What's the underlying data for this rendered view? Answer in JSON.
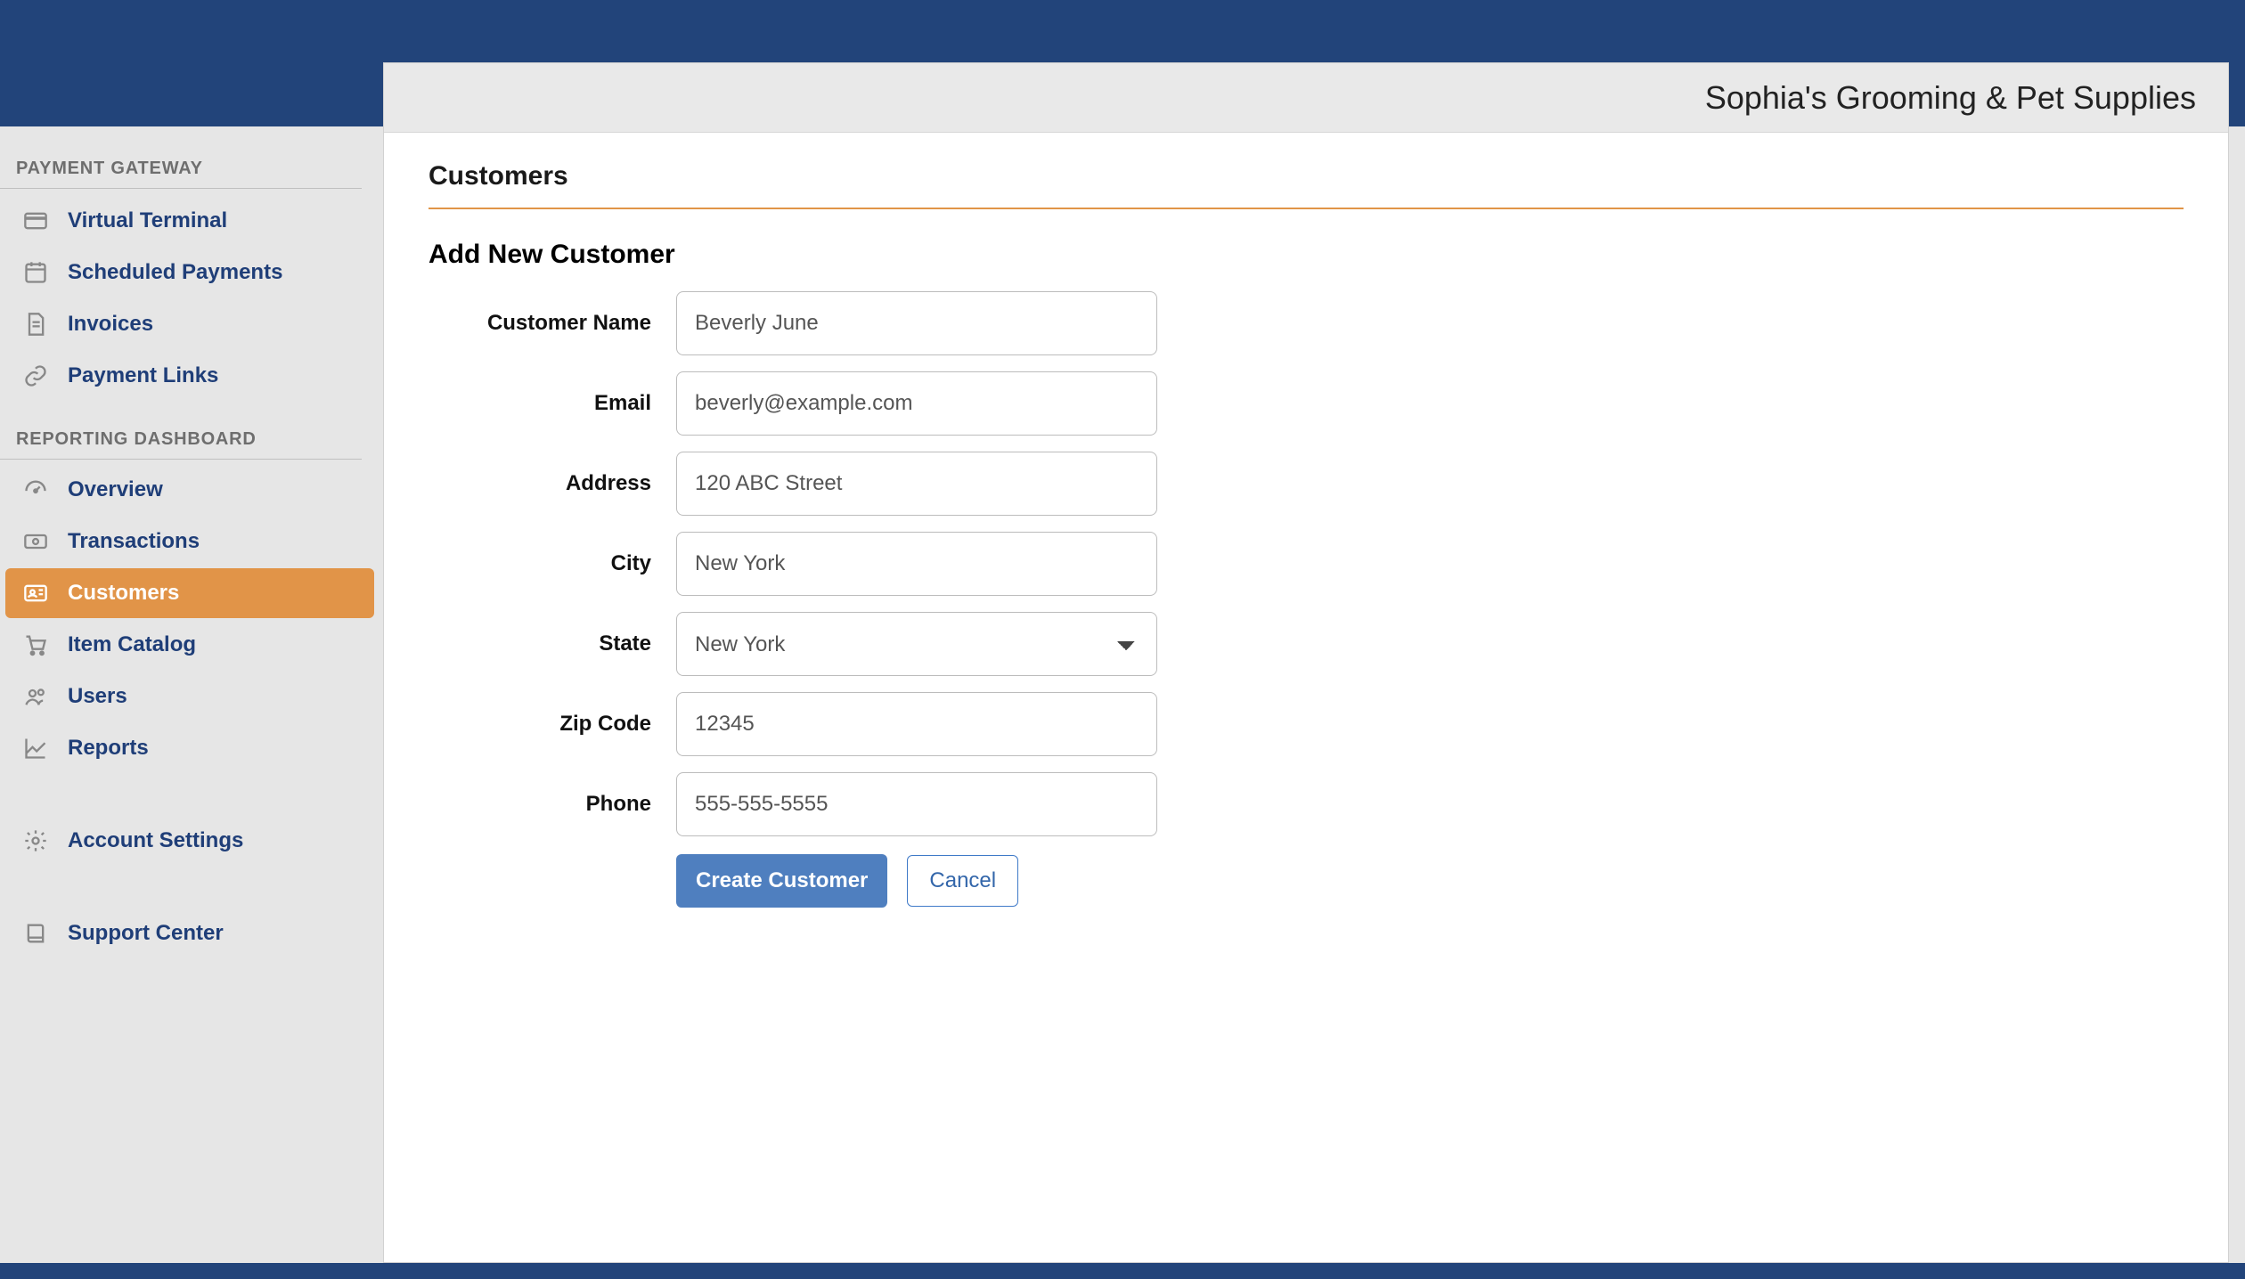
{
  "brand": "Sophia's Grooming & Pet Supplies",
  "sidebar": {
    "section1": {
      "title": "PAYMENT GATEWAY",
      "items": [
        {
          "id": "virtual-terminal",
          "label": "Virtual Terminal",
          "icon": "card-icon",
          "active": false
        },
        {
          "id": "scheduled-payments",
          "label": "Scheduled Payments",
          "icon": "calendar-icon",
          "active": false
        },
        {
          "id": "invoices",
          "label": "Invoices",
          "icon": "invoice-icon",
          "active": false
        },
        {
          "id": "payment-links",
          "label": "Payment Links",
          "icon": "link-icon",
          "active": false
        }
      ]
    },
    "section2": {
      "title": "REPORTING DASHBOARD",
      "items": [
        {
          "id": "overview",
          "label": "Overview",
          "icon": "gauge-icon",
          "active": false
        },
        {
          "id": "transactions",
          "label": "Transactions",
          "icon": "money-icon",
          "active": false
        },
        {
          "id": "customers",
          "label": "Customers",
          "icon": "idcard-icon",
          "active": true
        },
        {
          "id": "item-catalog",
          "label": "Item Catalog",
          "icon": "cart-icon",
          "active": false
        },
        {
          "id": "users",
          "label": "Users",
          "icon": "users-icon",
          "active": false
        },
        {
          "id": "reports",
          "label": "Reports",
          "icon": "chart-icon",
          "active": false
        }
      ],
      "extra": [
        {
          "id": "account-settings",
          "label": "Account Settings",
          "icon": "gear-icon",
          "active": false
        },
        {
          "id": "support-center",
          "label": "Support Center",
          "icon": "book-icon",
          "active": false
        }
      ]
    }
  },
  "main": {
    "page_title": "Customers",
    "subtitle": "Add New Customer",
    "form": {
      "customer_name": {
        "label": "Customer Name",
        "value": "Beverly June"
      },
      "email": {
        "label": "Email",
        "value": "beverly@example.com"
      },
      "address": {
        "label": "Address",
        "value": "120 ABC Street"
      },
      "city": {
        "label": "City",
        "value": "New York"
      },
      "state": {
        "label": "State",
        "value": "New York"
      },
      "zip": {
        "label": "Zip Code",
        "value": "12345"
      },
      "phone": {
        "label": "Phone",
        "value": "555-555-5555"
      }
    },
    "actions": {
      "create": "Create Customer",
      "cancel": "Cancel"
    }
  }
}
